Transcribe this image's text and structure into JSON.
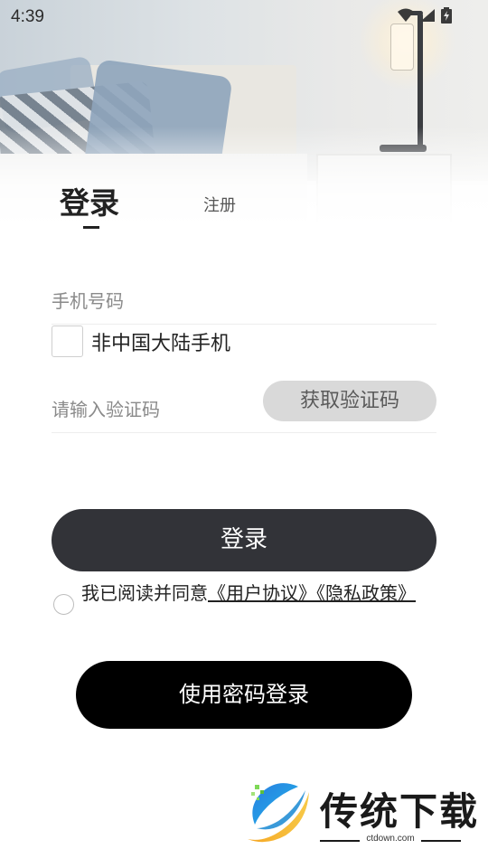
{
  "status_bar": {
    "time": "4:39",
    "icons": [
      "wifi-icon",
      "signal-icon",
      "battery-charging-icon"
    ]
  },
  "tabs": {
    "login": "登录",
    "register": "注册"
  },
  "form": {
    "phone_placeholder": "手机号码",
    "foreign_phone_label": "非中国大陆手机",
    "code_placeholder": "请输入验证码",
    "get_code_label": "获取验证码",
    "login_button": "登录"
  },
  "agreement": {
    "prefix": "我已阅读并同意",
    "link": "《用户协议》《隐私政策》"
  },
  "password_login_button": "使用密码登录",
  "watermark": {
    "title": "传统下载",
    "url": "ctdown.com"
  },
  "colors": {
    "login_button_bg": "#323338",
    "password_button_bg": "#000000",
    "get_code_bg": "#d9d9d9"
  }
}
